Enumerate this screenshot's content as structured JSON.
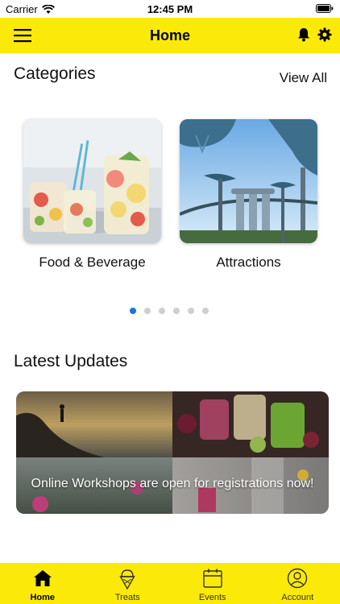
{
  "status_bar": {
    "carrier": "Carrier",
    "time": "12:45 PM"
  },
  "nav": {
    "title": "Home",
    "menu_icon": "hamburger-menu-icon",
    "bell_icon": "bell-icon",
    "settings_icon": "gear-icon"
  },
  "categories": {
    "title": "Categories",
    "view_all": "View All",
    "items": [
      {
        "label": "Food & Beverage"
      },
      {
        "label": "Attractions"
      }
    ],
    "page_count": 6,
    "active_page": 1
  },
  "latest_updates": {
    "title": "Latest Updates",
    "banner_text": "Online Workshops are open for registrations now!"
  },
  "tab_bar": {
    "tabs": [
      {
        "label": "Home",
        "icon": "home-icon",
        "active": true
      },
      {
        "label": "Treats",
        "icon": "ice-cream-icon",
        "active": false
      },
      {
        "label": "Events",
        "icon": "calendar-icon",
        "active": false
      },
      {
        "label": "Account",
        "icon": "account-icon",
        "active": false
      }
    ]
  },
  "colors": {
    "accent_yellow": "#fbea09",
    "active_dot": "#1a73e8",
    "inactive_dot": "#cfcfcf"
  }
}
